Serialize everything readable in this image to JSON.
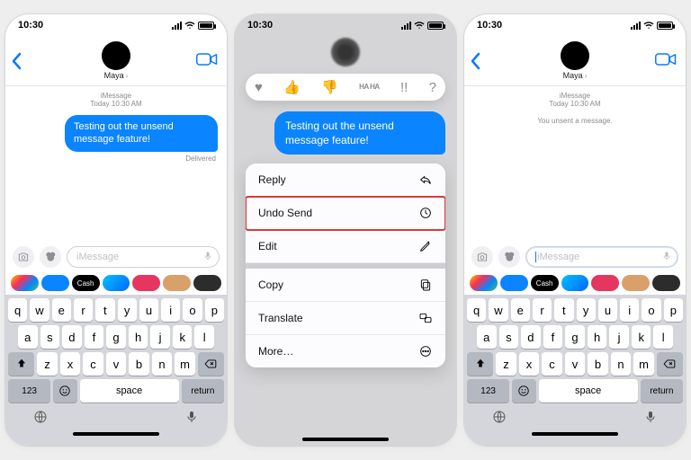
{
  "status": {
    "time": "10:30"
  },
  "contact": {
    "name": "Maya"
  },
  "thread": {
    "service_label": "iMessage",
    "timestamp": "Today 10:30 AM",
    "bubble_text": "Testing out the unsend message feature!",
    "delivery_status": "Delivered",
    "unsent_banner": "You unsent a message."
  },
  "composer": {
    "placeholder": "iMessage"
  },
  "tapback": {
    "heart": "♥",
    "thumbs_up": "👍",
    "thumbs_down": "👎",
    "haha": "HA\nHA",
    "exclaim": "!!",
    "question": "?"
  },
  "ctx": {
    "reply": "Reply",
    "undo_send": "Undo Send",
    "edit": "Edit",
    "copy": "Copy",
    "translate": "Translate",
    "more": "More…"
  },
  "keyboard": {
    "r1": [
      "q",
      "w",
      "e",
      "r",
      "t",
      "y",
      "u",
      "i",
      "o",
      "p"
    ],
    "r2": [
      "a",
      "s",
      "d",
      "f",
      "g",
      "h",
      "j",
      "k",
      "l"
    ],
    "r3": [
      "z",
      "x",
      "c",
      "v",
      "b",
      "n",
      "m"
    ],
    "num_label": "123",
    "space_label": "space",
    "return_label": "return"
  },
  "app_strip": [
    {
      "name": "photos",
      "bg": "linear-gradient(135deg,#f7c600,#ff2d55,#0a84ff,#34c759)"
    },
    {
      "name": "app-store",
      "bg": "#0a84ff"
    },
    {
      "name": "apple-cash",
      "bg": "#000",
      "label": "Cash"
    },
    {
      "name": "audio",
      "bg": "linear-gradient(135deg,#00c2ff,#0066ff)"
    },
    {
      "name": "search",
      "bg": "#e6355f"
    },
    {
      "name": "memoji-1",
      "bg": "#d9a06a"
    },
    {
      "name": "memoji-2",
      "bg": "#2c2c2c"
    }
  ]
}
